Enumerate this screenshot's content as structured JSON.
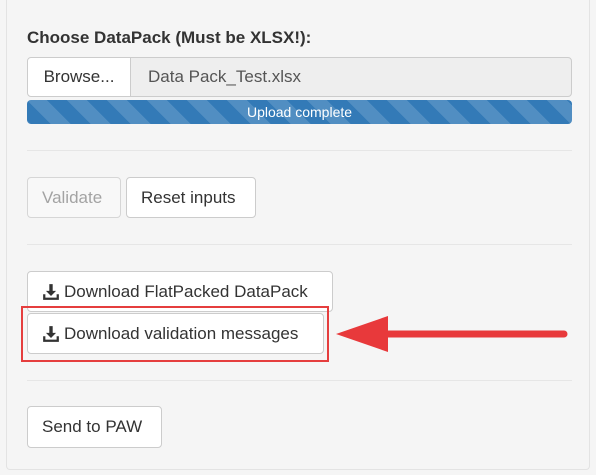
{
  "form": {
    "file_label": "Choose DataPack (Must be XLSX!):",
    "browse_label": "Browse...",
    "file_name": "Data Pack_Test.xlsx",
    "upload_progress": 1.0,
    "upload_status": "Upload complete"
  },
  "actions": {
    "validate_label": "Validate",
    "reset_label": "Reset inputs",
    "download_flatpacked_label": "Download FlatPacked DataPack",
    "download_validation_label": "Download validation messages",
    "send_label": "Send to PAW"
  },
  "annotation": {
    "highlight_color": "#e53e3e",
    "arrow_color": "#e8393b",
    "highlighted_item": "Download validation messages"
  },
  "icons": {
    "download": "download-icon",
    "arrow": "arrow-left-icon"
  },
  "colors": {
    "progress_bar": "#337ab7",
    "panel_background": "#f5f5f5"
  }
}
